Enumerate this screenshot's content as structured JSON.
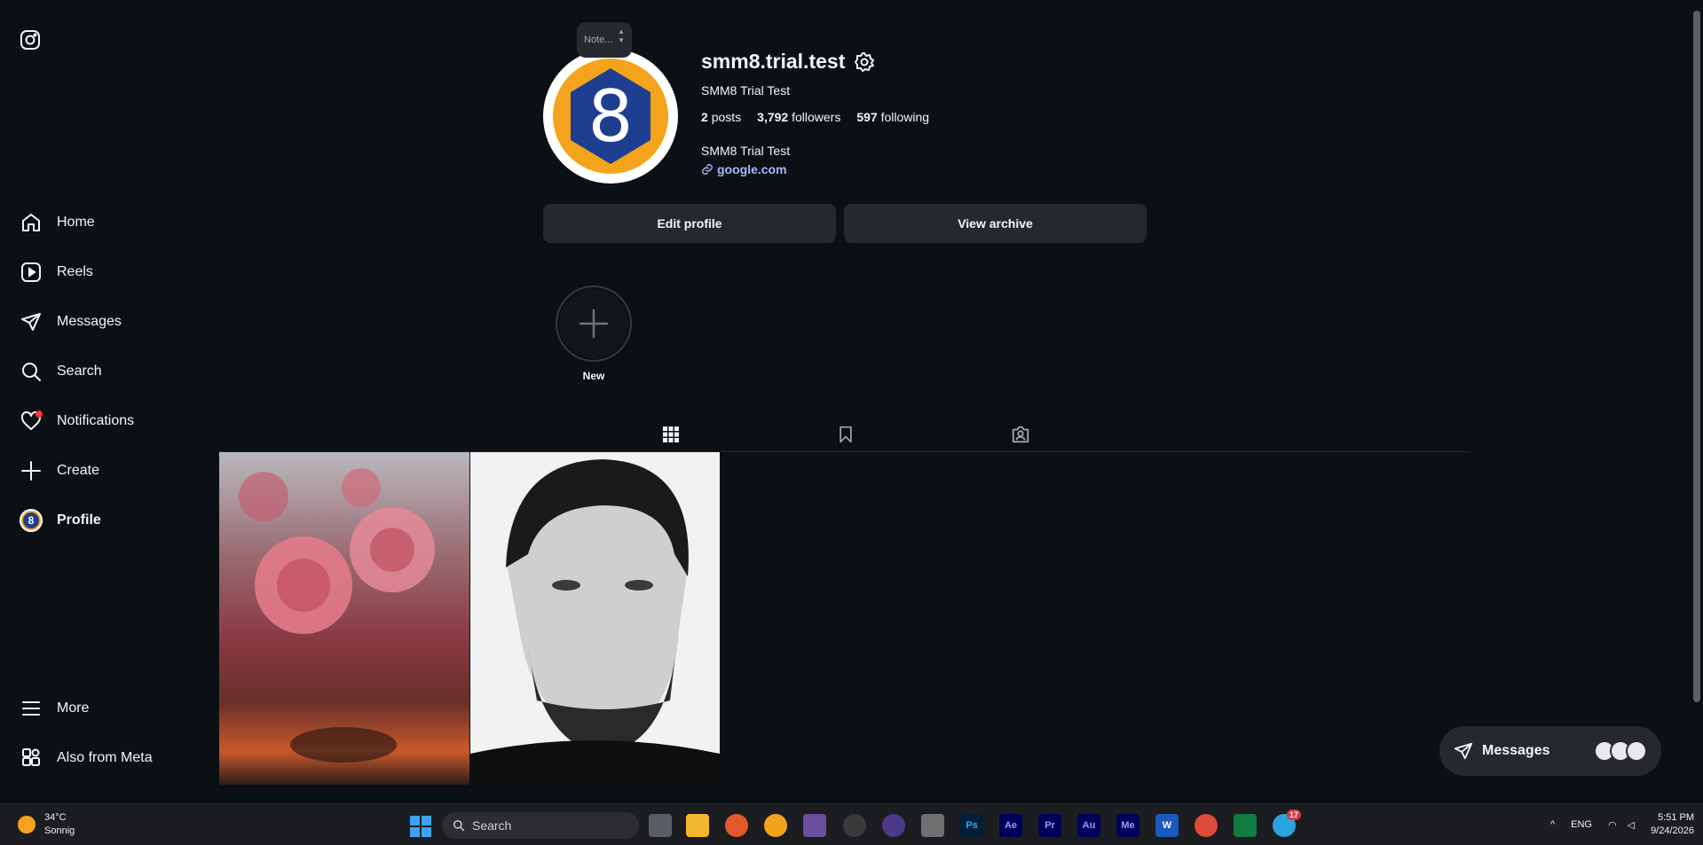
{
  "sidebar": {
    "items": [
      {
        "label": "Home",
        "icon": "home-icon"
      },
      {
        "label": "Reels",
        "icon": "reels-icon"
      },
      {
        "label": "Messages",
        "icon": "send-icon"
      },
      {
        "label": "Search",
        "icon": "search-icon"
      },
      {
        "label": "Notifications",
        "icon": "heart-icon"
      },
      {
        "label": "Create",
        "icon": "plus-icon"
      },
      {
        "label": "Profile",
        "icon": "avatar"
      }
    ],
    "bottom": [
      {
        "label": "More",
        "icon": "menu-icon"
      },
      {
        "label": "Also from Meta",
        "icon": "meta-grid-icon"
      }
    ]
  },
  "profile": {
    "note": "Note...",
    "avatar_digit": "8",
    "username": "smm8.trial.test",
    "full_name": "SMM8 Trial Test",
    "stats": {
      "posts_count": "2",
      "posts_label": "posts",
      "followers_count": "3,792",
      "followers_label": "followers",
      "following_count": "597",
      "following_label": "following"
    },
    "bio": "SMM8 Trial Test",
    "link": "google.com",
    "edit_label": "Edit profile",
    "archive_label": "View archive",
    "highlight_new_label": "New"
  },
  "tabs": [
    "grid-icon",
    "bookmark-icon",
    "tagged-icon"
  ],
  "messages_pill": {
    "label": "Messages"
  },
  "taskbar": {
    "weather_temp": "34°C",
    "weather_desc": "Sonnig",
    "search_placeholder": "Search",
    "apps": [
      {
        "name": "ps-icon",
        "text": "Ps",
        "color": "#001e36",
        "fg": "#31a8ff"
      },
      {
        "name": "ae-icon",
        "text": "Ae",
        "color": "#00005b",
        "fg": "#9999ff"
      },
      {
        "name": "pr-icon",
        "text": "Pr",
        "color": "#00005b",
        "fg": "#9999ff"
      },
      {
        "name": "au-icon",
        "text": "Au",
        "color": "#00005b",
        "fg": "#9999ff"
      },
      {
        "name": "me-icon",
        "text": "Me",
        "color": "#00005b",
        "fg": "#9999ff"
      },
      {
        "name": "word-icon",
        "text": "W",
        "color": "#185abd",
        "fg": "#ffffff"
      }
    ],
    "telegram_badge": "17",
    "lang": "ENG",
    "time": "5:51 PM",
    "date": "9/24/2026"
  }
}
